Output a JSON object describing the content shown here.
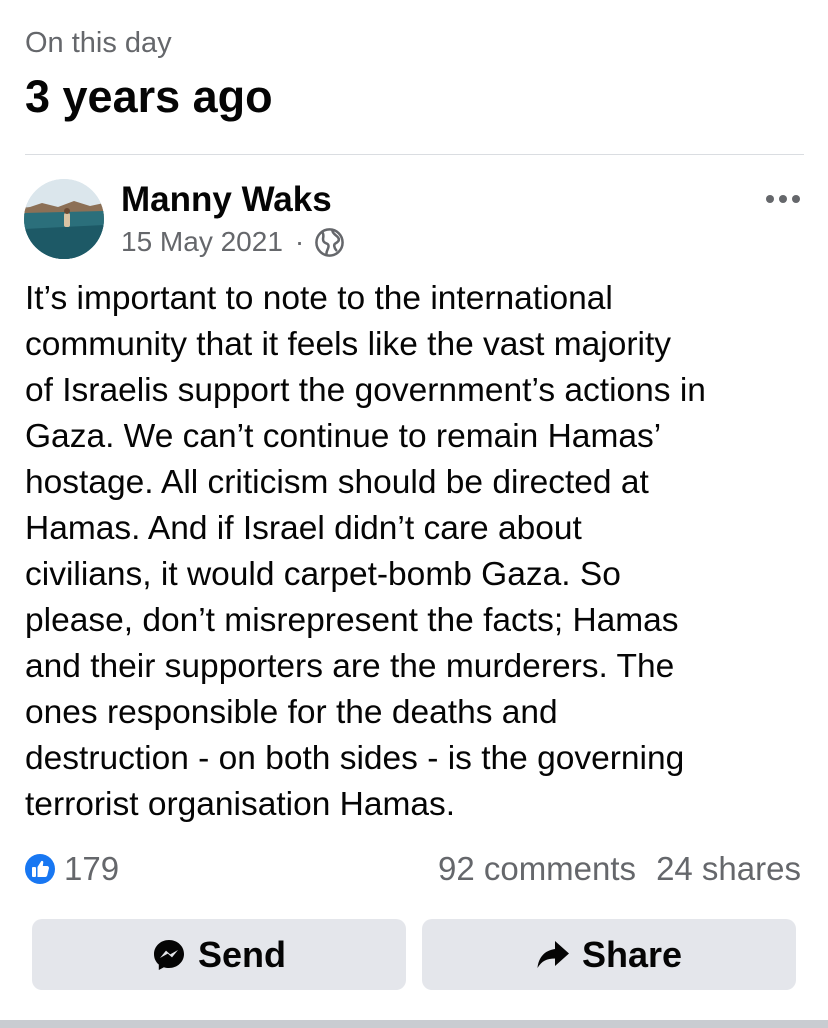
{
  "memory": {
    "label": "On this day",
    "title": "3 years ago"
  },
  "post": {
    "author": "Manny Waks",
    "date": "15 May 2021",
    "separator": "·",
    "privacy_icon": "globe-icon",
    "more_icon": "more-horizontal-icon",
    "body": "It’s important to note to the international\ncommunity that it feels like the vast majority\nof Israelis support the government’s actions in\nGaza. We can’t continue to remain Hamas’\nhostage. All criticism should be directed at\nHamas. And if Israel didn’t care about\ncivilians, it would carpet-bomb Gaza. So\nplease, don’t misrepresent the facts; Hamas\nand their supporters are the murderers. The\nones responsible for the deaths and\ndestruction - on both sides - is the governing\nterrorist organisation Hamas."
  },
  "stats": {
    "likes": "179",
    "comments": "92 comments",
    "shares": "24 shares"
  },
  "actions": {
    "send_label": "Send",
    "share_label": "Share"
  },
  "colors": {
    "like_blue": "#1877f2",
    "button_bg": "#e4e6eb",
    "secondary_text": "#65676b"
  }
}
